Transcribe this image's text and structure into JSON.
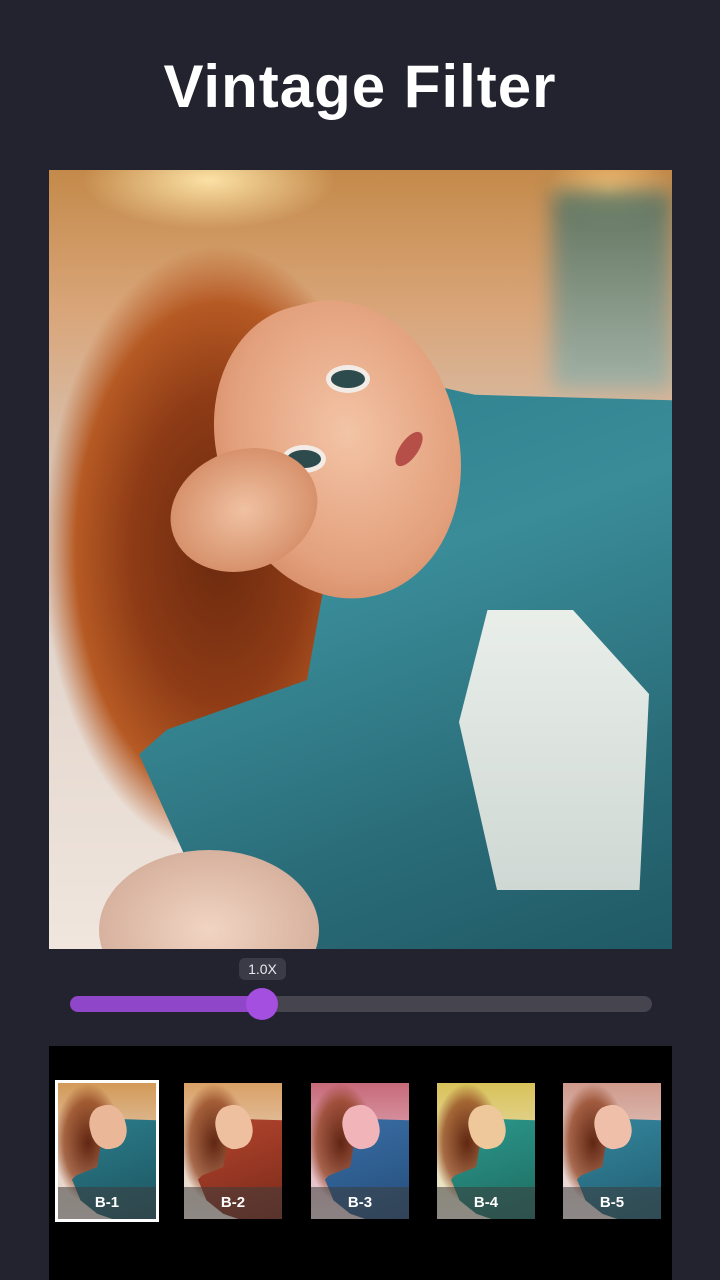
{
  "title": "Vintage Filter",
  "slider": {
    "value_label": "1.0X",
    "fill_fraction": 0.33
  },
  "filters": [
    {
      "label": "B-1",
      "selected": true
    },
    {
      "label": "B-2",
      "selected": false
    },
    {
      "label": "B-3",
      "selected": false
    },
    {
      "label": "B-4",
      "selected": false
    },
    {
      "label": "B-5",
      "selected": false
    }
  ],
  "colors": {
    "background": "#23222f",
    "accent": "#a44fe0",
    "slider_fill": "#8f46c8"
  }
}
